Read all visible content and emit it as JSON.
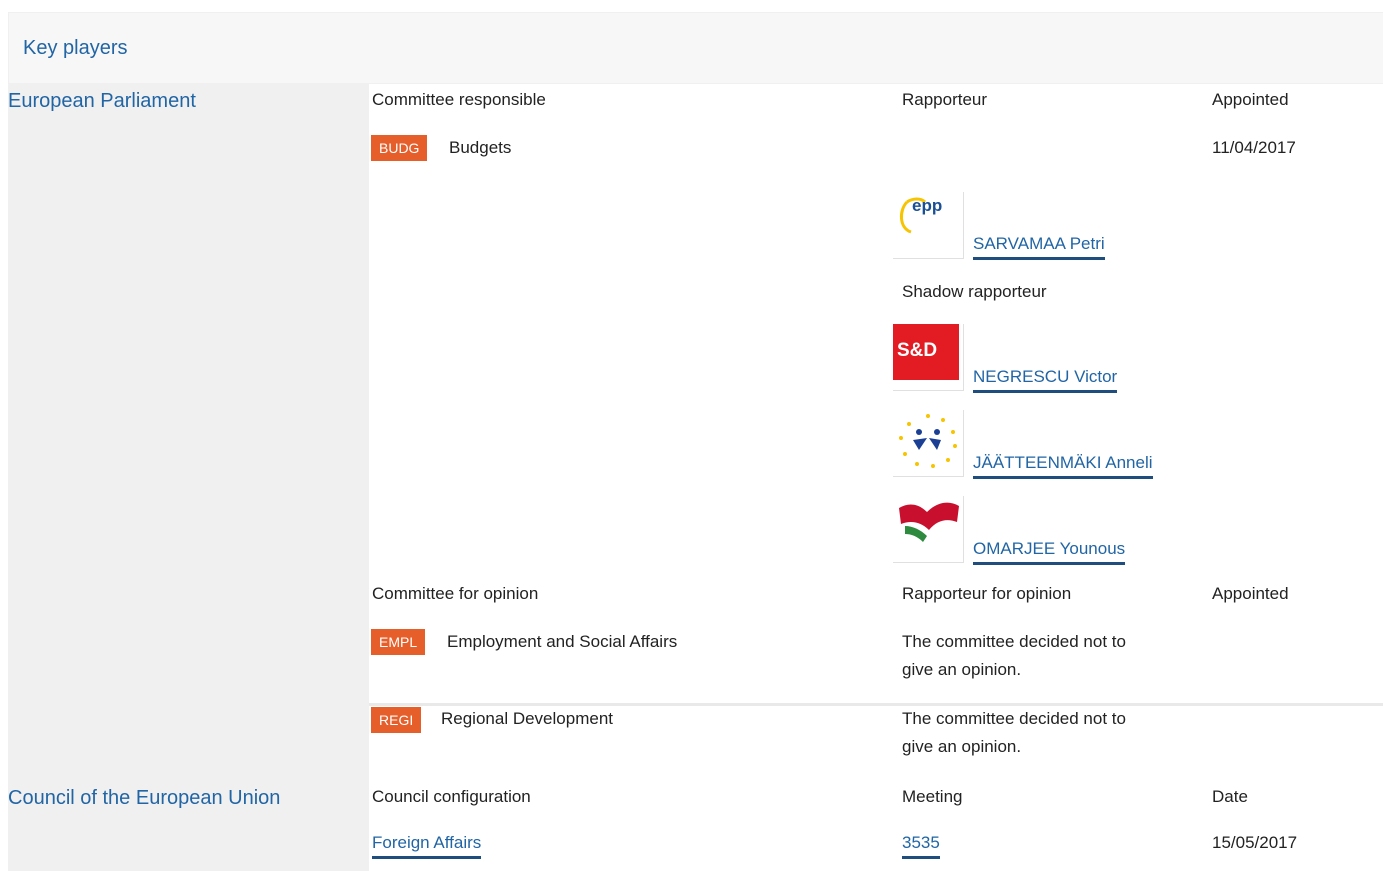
{
  "header": {
    "title": "Key players"
  },
  "ep": {
    "label": "European Parliament",
    "committee_responsible": {
      "head_committee": "Committee responsible",
      "head_rapporteur": "Rapporteur",
      "head_appointed": "Appointed",
      "code": "BUDG",
      "name": "Budgets",
      "date": "11/04/2017",
      "rapporteur": {
        "logo_text": "epp",
        "name": "SARVAMAA Petri"
      },
      "shadow_label": "Shadow rapporteur",
      "shadows": [
        {
          "logo_text": "S&D",
          "name": "NEGRESCU Victor"
        },
        {
          "logo_text": "",
          "name": "JÄÄTTEENMÄKI Anneli"
        },
        {
          "logo_text": "",
          "name": "OMARJEE Younous"
        }
      ]
    },
    "opinion": {
      "head_committee": "Committee for opinion",
      "head_rapporteur": "Rapporteur for opinion",
      "head_appointed": "Appointed",
      "rows": [
        {
          "code": "EMPL",
          "name": "Employment and Social Affairs",
          "line1": "The committee decided not to",
          "line2": "give an opinion."
        },
        {
          "code": "REGI",
          "name": "Regional Development",
          "line1": "The committee decided not to",
          "line2": "give an opinion."
        }
      ]
    }
  },
  "council": {
    "label": "Council of the European Union",
    "head_config": "Council configuration",
    "head_meeting": "Meeting",
    "head_date": "Date",
    "config": "Foreign Affairs",
    "meeting": "3535",
    "date": "15/05/2017"
  },
  "colors": {
    "accent": "#2165a5",
    "badge": "#e65e2a",
    "link_underline": "#1f4e7e"
  }
}
